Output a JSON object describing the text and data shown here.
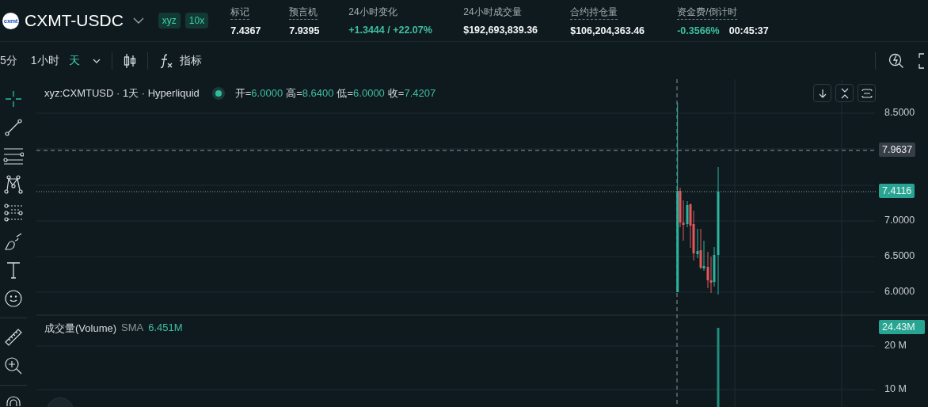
{
  "header": {
    "logo_text": "cxmt",
    "symbol": "CXMT-USDC",
    "badges": [
      "xyz",
      "10x"
    ],
    "stats": [
      {
        "label": "标记",
        "underlined": true,
        "values": [
          {
            "text": "7.4367",
            "color": "#f3f5f6"
          }
        ]
      },
      {
        "label": "预言机",
        "underlined": true,
        "values": [
          {
            "text": "7.9395",
            "color": "#f3f5f6"
          }
        ]
      },
      {
        "label": "24小时变化",
        "underlined": false,
        "values": [
          {
            "text": "+1.3444 / +22.07%",
            "color": "#3fbf9f"
          }
        ]
      },
      {
        "label": "24小时成交量",
        "underlined": false,
        "values": [
          {
            "text": "$192,693,839.36",
            "color": "#f3f5f6"
          }
        ]
      },
      {
        "label": "合约持仓量",
        "underlined": true,
        "values": [
          {
            "text": "$106,204,363.46",
            "color": "#f3f5f6"
          }
        ]
      },
      {
        "label": "资金费/倒计时",
        "underlined": true,
        "values": [
          {
            "text": "-0.3566%",
            "color": "#3fbf9f"
          },
          {
            "text": "00:45:37",
            "color": "#f3f5f6"
          }
        ]
      }
    ]
  },
  "toolbar": {
    "intervals": [
      {
        "label": "5分",
        "selected": false
      },
      {
        "label": "1小时",
        "selected": false
      },
      {
        "label": "天",
        "selected": true
      }
    ],
    "indicators_label": "指标"
  },
  "chart": {
    "legend": {
      "title": "xyz:CXMTUSD · 1天 · Hyperliquid",
      "ohlc": [
        {
          "label": "开=",
          "value": "6.0000"
        },
        {
          "label": "高=",
          "value": "8.6400"
        },
        {
          "label": "低=",
          "value": "6.0000"
        },
        {
          "label": "收=",
          "value": "7.4207"
        }
      ]
    },
    "price_ticks": [
      "8.5000",
      "7.0000",
      "6.5000",
      "6.0000"
    ],
    "crosshair_price": "7.9637",
    "last_price": "7.4116",
    "volume_legend": {
      "title": "成交量(Volume)",
      "indicator": "SMA",
      "value": "6.451M"
    },
    "volume_ticks": [
      "20 M",
      "10 M"
    ],
    "last_volume": "24.43M"
  }
}
